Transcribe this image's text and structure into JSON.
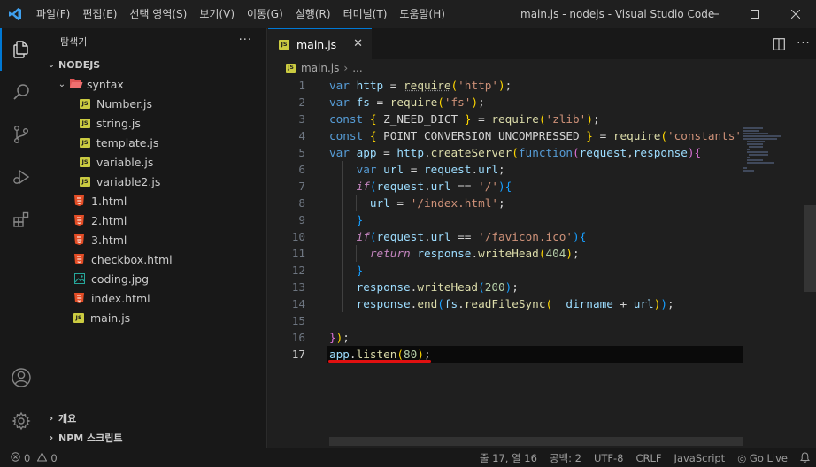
{
  "window": {
    "title": "main.js - nodejs - Visual Studio Code"
  },
  "menu": [
    "파일(F)",
    "편집(E)",
    "선택 영역(S)",
    "보기(V)",
    "이동(G)",
    "실행(R)",
    "터미널(T)",
    "도움말(H)"
  ],
  "sidebar": {
    "title": "탐색기",
    "root": "NODEJS",
    "folder": "syntax",
    "folder_files": [
      "Number.js",
      "string.js",
      "template.js",
      "variable.js",
      "variable2.js"
    ],
    "files": [
      {
        "name": "1.html",
        "type": "html"
      },
      {
        "name": "2.html",
        "type": "html"
      },
      {
        "name": "3.html",
        "type": "html"
      },
      {
        "name": "checkbox.html",
        "type": "html"
      },
      {
        "name": "coding.jpg",
        "type": "image"
      },
      {
        "name": "index.html",
        "type": "html"
      },
      {
        "name": "main.js",
        "type": "js"
      }
    ],
    "outline": "개요",
    "npm_scripts": "NPM 스크립트"
  },
  "editor": {
    "tab_label": "main.js",
    "breadcrumb_file": "main.js",
    "breadcrumb_rest": "...",
    "line_numbers": [
      "1",
      "2",
      "3",
      "4",
      "5",
      "6",
      "7",
      "8",
      "9",
      "10",
      "11",
      "12",
      "13",
      "14",
      "15",
      "16",
      "17"
    ],
    "active_line": 17
  },
  "statusbar": {
    "errors": "0",
    "warnings": "0",
    "position": "줄 17, 열 16",
    "spaces": "공백: 2",
    "encoding": "UTF-8",
    "eol": "CRLF",
    "language": "JavaScript",
    "golive": "Go Live"
  },
  "colors": {
    "accent": "#0078d4",
    "keyword": "#569cd6",
    "string": "#ce9178",
    "function": "#dcdcaa",
    "variable": "#9cdcfe",
    "number": "#b5cea8",
    "underline": "#e01010"
  },
  "icons": [
    "vscode-logo-icon",
    "explorer-icon",
    "search-icon",
    "source-control-icon",
    "run-debug-icon",
    "extensions-icon",
    "account-icon",
    "settings-gear-icon",
    "split-editor-icon",
    "more-actions-icon",
    "close-icon",
    "bell-icon",
    "broadcast-icon"
  ]
}
